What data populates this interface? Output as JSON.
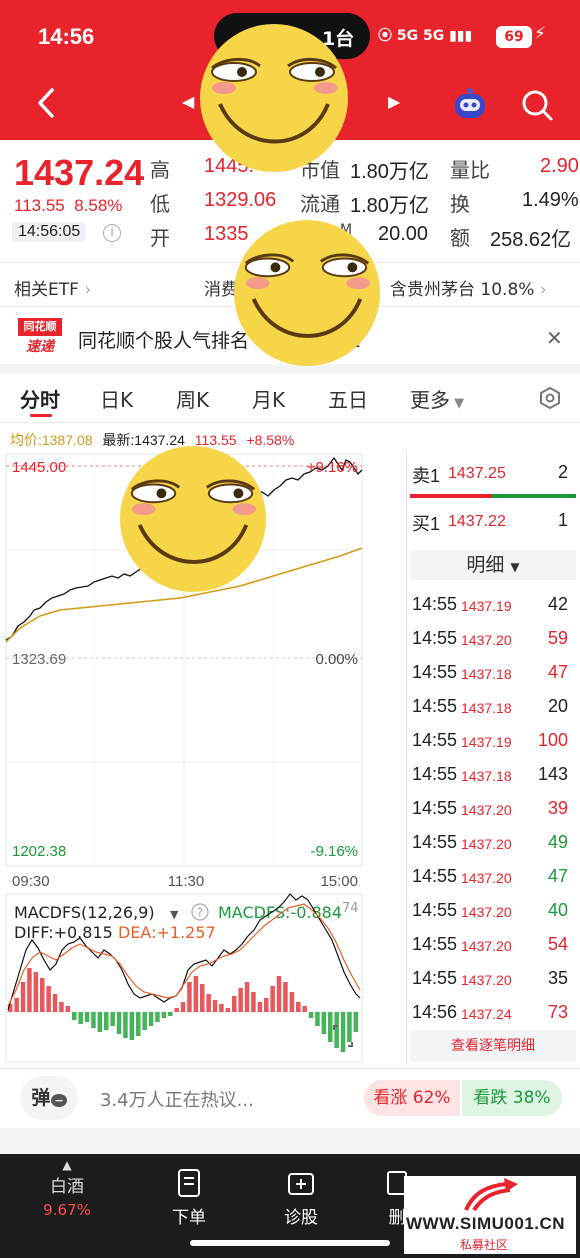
{
  "status": {
    "time": "14:56",
    "island_text": "1台",
    "network": "5G 5G",
    "battery": "69"
  },
  "header": {
    "tag": "通"
  },
  "quote": {
    "price": "1437.24",
    "change_abs": "113.55",
    "change_pct": "8.58%",
    "time": "14:56:05",
    "rows": [
      {
        "l1": "高",
        "v1": "1445.",
        "l2": "市值",
        "v2": "1.80万亿",
        "l3": "量比",
        "v3": "2.90"
      },
      {
        "l1": "低",
        "v1": "1329.06",
        "l2": "流通",
        "v2": "1.80万亿",
        "l3": "换",
        "v3": "1.49%"
      },
      {
        "l1": "开",
        "v1": "1335",
        "l2": "M",
        "v2": "20.00",
        "l3": "额",
        "v3": "258.62亿"
      }
    ]
  },
  "etf": {
    "label": "相关ETF",
    "mid": "消费",
    "right": "含贵州茅台 10.8%"
  },
  "news": {
    "badge_top": "同花顺",
    "badge_bottom": "速递",
    "text": "同花顺个股人气排名",
    "suffix": "1"
  },
  "tabs": [
    "分时",
    "日K",
    "周K",
    "月K",
    "五日",
    "更多"
  ],
  "legend": {
    "avg": "均价:1387.08",
    "latest": "最新:1437.24",
    "chg": "113.55",
    "pct": "+8.58%"
  },
  "chart": {
    "y_top": "1445.00",
    "y_top_pct": "+9.16%",
    "y_mid": "1323.69",
    "y_mid_pct": "0.00%",
    "y_bot": "1202.38",
    "y_bot_pct": "-9.16%",
    "x_labels": [
      "09:30",
      "11:30",
      "15:00"
    ],
    "macd_title": "MACDFS(12,26,9)",
    "macd_value": "MACDFS:-0.884",
    "macd_right": "74",
    "diff": "DIFF:+0.815",
    "dea": "DEA:+1.257"
  },
  "chart_data": {
    "type": "line",
    "x": [
      "09:30",
      "11:30",
      "15:00"
    ],
    "series": [
      {
        "name": "最新",
        "values": [
          1330,
          1392,
          1437.24
        ]
      },
      {
        "name": "均价",
        "values": [
          1333,
          1362,
          1387.08
        ]
      }
    ],
    "ylim": [
      1202.38,
      1445.0
    ]
  },
  "orderbook": {
    "ask": {
      "label": "卖1",
      "price": "1437.25",
      "vol": "2"
    },
    "bid": {
      "label": "买1",
      "price": "1437.22",
      "vol": "1"
    },
    "detail_label": "明细",
    "trades": [
      {
        "t": "14:55",
        "p": "1437.19",
        "v": "42",
        "c": "dark"
      },
      {
        "t": "14:55",
        "p": "1437.20",
        "v": "59",
        "c": "red"
      },
      {
        "t": "14:55",
        "p": "1437.18",
        "v": "47",
        "c": "red"
      },
      {
        "t": "14:55",
        "p": "1437.18",
        "v": "20",
        "c": "dark"
      },
      {
        "t": "14:55",
        "p": "1437.19",
        "v": "100",
        "c": "red"
      },
      {
        "t": "14:55",
        "p": "1437.18",
        "v": "143",
        "c": "dark"
      },
      {
        "t": "14:55",
        "p": "1437.20",
        "v": "39",
        "c": "red"
      },
      {
        "t": "14:55",
        "p": "1437.20",
        "v": "49",
        "c": "green"
      },
      {
        "t": "14:55",
        "p": "1437.20",
        "v": "47",
        "c": "green"
      },
      {
        "t": "14:55",
        "p": "1437.20",
        "v": "40",
        "c": "green"
      },
      {
        "t": "14:55",
        "p": "1437.20",
        "v": "54",
        "c": "red"
      },
      {
        "t": "14:55",
        "p": "1437.20",
        "v": "35",
        "c": "dark"
      },
      {
        "t": "14:56",
        "p": "1437.24",
        "v": "73",
        "c": "red"
      }
    ],
    "footer": "查看逐笔明细"
  },
  "comment": {
    "danmu": "弹",
    "text": "3.4万人正在热议...",
    "bull": "看涨 62%",
    "bear": "看跌 38%"
  },
  "bottom_nav": [
    {
      "label": "白酒",
      "sub": "9.67%"
    },
    {
      "label": "下单",
      "sub": ""
    },
    {
      "label": "诊股",
      "sub": ""
    },
    {
      "label": "删",
      "sub": ""
    }
  ],
  "watermark": {
    "text": "WWW.SIMU001.CN",
    "sub": "私募社区"
  },
  "colors": {
    "red": "#e8232b",
    "green": "#1a9a3b",
    "avg_line": "#d49a17"
  }
}
